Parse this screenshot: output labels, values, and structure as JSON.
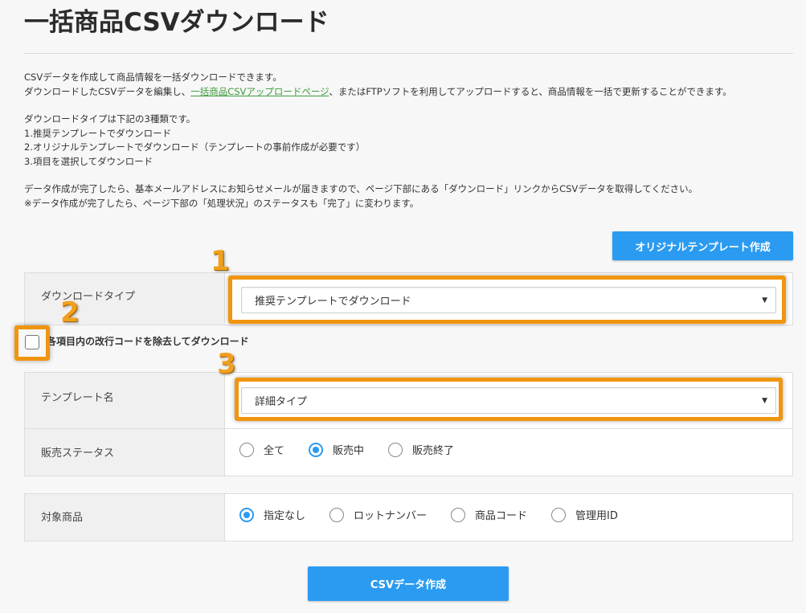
{
  "page": {
    "title": "一括商品CSVダウンロード"
  },
  "intro": {
    "line1": "CSVデータを作成して商品情報を一括ダウンロードできます。",
    "line2_before": "ダウンロードしたCSVデータを編集し、",
    "line2_link": "一括商品CSVアップロードページ",
    "line2_after": "、またはFTPソフトを利用してアップロードすると、商品情報を一括で更新することができます。",
    "types_heading": "ダウンロードタイプは下記の3種類です。",
    "type1": "1.推奨テンプレートでダウンロード",
    "type2": "2.オリジナルテンプレートでダウンロード（テンプレートの事前作成が必要です）",
    "type3": "3.項目を選択してダウンロード",
    "note1": "データ作成が完了したら、基本メールアドレスにお知らせメールが届きますので、ページ下部にある「ダウンロード」リンクからCSVデータを取得してください。",
    "note2": "※データ作成が完了したら、ページ下部の「処理状況」のステータスも「完了」に変わります。"
  },
  "buttons": {
    "create_template": "オリジナルテンプレート作成",
    "create_csv": "CSVデータ作成"
  },
  "form": {
    "download_type": {
      "label": "ダウンロードタイプ",
      "selected": "推奨テンプレートでダウンロード"
    },
    "remove_newline": {
      "label": "各項目内の改行コードを除去してダウンロード",
      "checked": false
    },
    "template_name": {
      "label": "テンプレート名",
      "selected": "詳細タイプ"
    },
    "sales_status": {
      "label": "販売ステータス",
      "options": [
        "全て",
        "販売中",
        "販売終了"
      ],
      "selected": "販売中"
    },
    "target_products": {
      "label": "対象商品",
      "options": [
        "指定なし",
        "ロットナンバー",
        "商品コード",
        "管理用ID"
      ],
      "selected": "指定なし"
    }
  },
  "annotations": {
    "n1": "1",
    "n2": "2",
    "n3": "3",
    "color": "#f0950f"
  },
  "colors": {
    "accent": "#2b9bf1",
    "link": "#3c9a3c"
  },
  "icons": {
    "select_arrow": "▼"
  }
}
